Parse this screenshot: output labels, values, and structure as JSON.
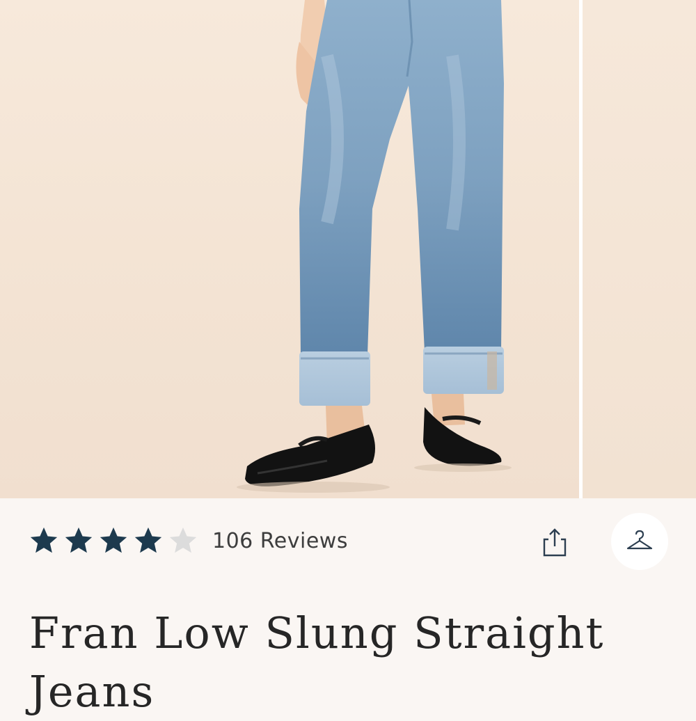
{
  "product": {
    "title": "Fran Low Slung Straight Jeans",
    "rating": 4,
    "rating_max": 5,
    "reviews_label": "106 Reviews"
  },
  "actions": {
    "share_icon": "share-icon",
    "wishlist_icon": "hanger-icon"
  },
  "gallery": {
    "images": [
      "model-in-jeans-photo",
      "next-photo"
    ]
  },
  "colors": {
    "star_filled": "#1d3a4e",
    "star_empty": "#dcdcdc",
    "title_text": "#262626",
    "background": "#faf6f3"
  }
}
